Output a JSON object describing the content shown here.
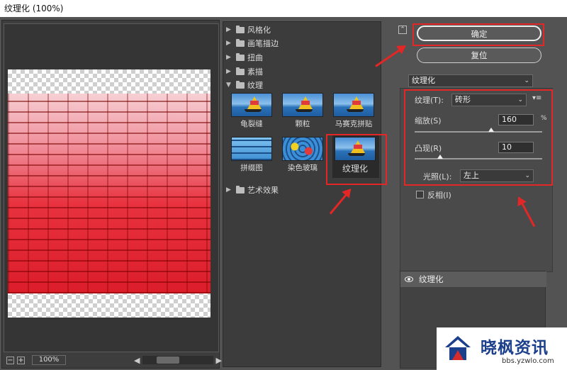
{
  "window": {
    "title": "纹理化 (100%)"
  },
  "preview": {
    "zoom_out": "−",
    "zoom_in": "+",
    "zoom_value": "100%"
  },
  "gallery": {
    "categories": [
      {
        "label": "风格化"
      },
      {
        "label": "画笔描边"
      },
      {
        "label": "扭曲"
      },
      {
        "label": "素描"
      },
      {
        "label": "纹理"
      },
      {
        "label": "艺术效果"
      }
    ],
    "filters": [
      {
        "label": "龟裂缝"
      },
      {
        "label": "颗粒"
      },
      {
        "label": "马赛克拼贴"
      },
      {
        "label": "拼缀图"
      },
      {
        "label": "染色玻璃"
      },
      {
        "label": "纹理化"
      }
    ]
  },
  "actions": {
    "ok": "确定",
    "reset": "复位"
  },
  "filter_select": {
    "value": "纹理化"
  },
  "params": {
    "texture_label": "纹理(T):",
    "texture_value": "砖形",
    "scale_label": "缩放(S)",
    "scale_value": "160",
    "scale_unit": "%",
    "scale_fraction": 0.6,
    "relief_label": "凸现(R)",
    "relief_value": "10",
    "relief_fraction": 0.2,
    "light_label": "光照(L):",
    "light_value": "左上",
    "invert_label": "反相(I)"
  },
  "layers": {
    "items": [
      {
        "label": "纹理化"
      }
    ]
  },
  "watermark": {
    "title": "晓枫资讯",
    "url": "bbs.yzwlo.com"
  },
  "colors": {
    "highlight": "#e32626",
    "panel": "#535353",
    "brand": "#1c3f8c"
  }
}
